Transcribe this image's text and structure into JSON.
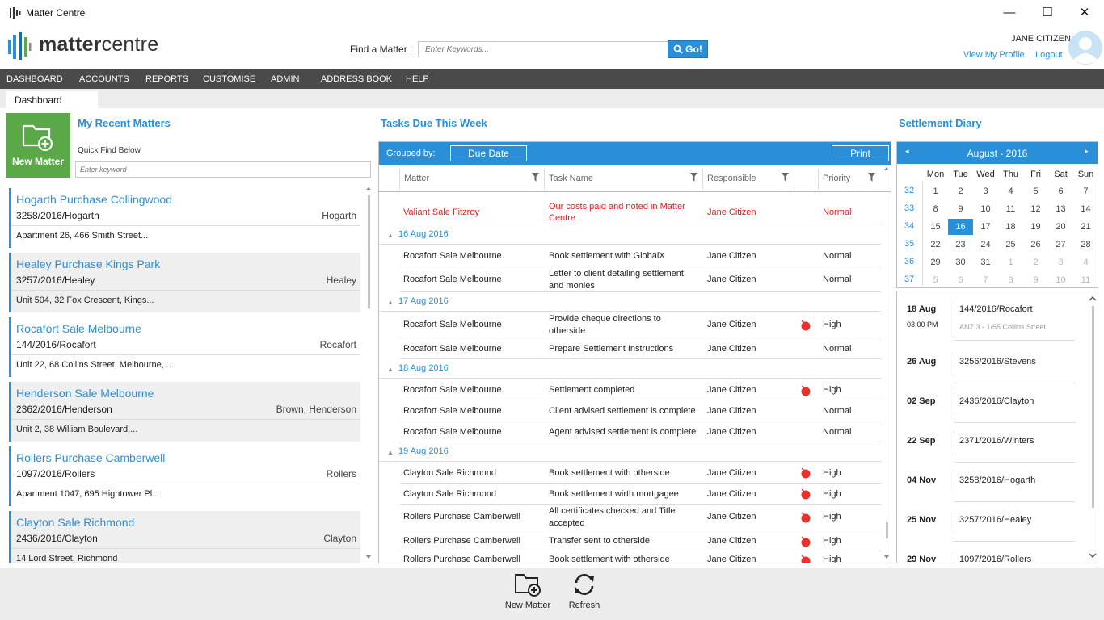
{
  "window": {
    "title": "Matter Centre",
    "minimize": "—",
    "maximize": "☐",
    "close": "✕"
  },
  "logo": {
    "text_bold": "matter",
    "text_light": "centre"
  },
  "header": {
    "find_label": "Find a Matter :",
    "find_placeholder": "Enter Keywords...",
    "go_label": "Go!",
    "user_name": "JANE CITIZEN",
    "view_profile": "View My Profile",
    "separator": "|",
    "logout": "Logout"
  },
  "menu": [
    "DASHBOARD",
    "ACCOUNTS",
    "REPORTS",
    "CUSTOMISE",
    "ADMIN",
    "ADDRESS BOOK",
    "HELP"
  ],
  "tab": {
    "label": "Dashboard"
  },
  "recent": {
    "new_matter_label": "New Matter",
    "title": "My Recent Matters",
    "quick_find_label": "Quick Find Below",
    "quick_find_placeholder": "Enter keyword",
    "matters": [
      {
        "title": "Hogarth Purchase Collingwood",
        "number": "3258/2016/Hogarth",
        "client": "Hogarth",
        "address": "Apartment 26, 466 Smith Street..."
      },
      {
        "title": "Healey Purchase Kings Park",
        "number": "3257/2016/Healey",
        "client": "Healey",
        "address": "Unit 504, 32 Fox Crescent, Kings..."
      },
      {
        "title": "Rocafort Sale Melbourne",
        "number": "144/2016/Rocafort",
        "client": "Rocafort",
        "address": "Unit 22, 68 Collins Street, Melbourne,..."
      },
      {
        "title": "Henderson Sale Melbourne",
        "number": "2362/2016/Henderson",
        "client": "Brown, Henderson",
        "address": "Unit 2, 38 William Boulevard,..."
      },
      {
        "title": "Rollers Purchase Camberwell",
        "number": "1097/2016/Rollers",
        "client": "Rollers",
        "address": "Apartment 1047, 695 Hightower Pl..."
      },
      {
        "title": "Clayton Sale Richmond",
        "number": "2436/2016/Clayton",
        "client": "Clayton",
        "address": "14 Lord Street, Richmond"
      }
    ]
  },
  "tasks": {
    "title": "Tasks Due This Week",
    "grouped_by_label": "Grouped by:",
    "group_button": "Due Date",
    "print_button": "Print",
    "columns": {
      "matter": "Matter",
      "task": "Task Name",
      "responsible": "Responsible",
      "priority": "Priority"
    },
    "partial_row": {
      "matter": "Valiant Sale Fitzroy",
      "task": "Our costs paid and noted in Matter Centre",
      "responsible": "Jane Citizen",
      "priority": "Normal"
    },
    "groups": [
      {
        "date": "16 Aug 2016",
        "rows": [
          {
            "matter": "Rocafort Sale Melbourne",
            "task": "Book settlement with GlobalX",
            "responsible": "Jane Citizen",
            "priority": "Normal",
            "flag": false
          },
          {
            "matter": "Rocafort Sale Melbourne",
            "task": "Letter to client detailing settlement and monies",
            "responsible": "Jane Citizen",
            "priority": "Normal",
            "flag": false
          }
        ]
      },
      {
        "date": "17 Aug 2016",
        "rows": [
          {
            "matter": "Rocafort Sale Melbourne",
            "task": "Provide cheque directions to otherside",
            "responsible": "Jane Citizen",
            "priority": "High",
            "flag": true
          },
          {
            "matter": "Rocafort Sale Melbourne",
            "task": "Prepare Settlement Instructions",
            "responsible": "Jane Citizen",
            "priority": "Normal",
            "flag": false
          }
        ]
      },
      {
        "date": "18 Aug 2016",
        "rows": [
          {
            "matter": "Rocafort Sale Melbourne",
            "task": "Settlement completed",
            "responsible": "Jane Citizen",
            "priority": "High",
            "flag": true
          },
          {
            "matter": "Rocafort Sale Melbourne",
            "task": "Client advised settlement is complete",
            "responsible": "Jane Citizen",
            "priority": "Normal",
            "flag": false
          },
          {
            "matter": "Rocafort Sale Melbourne",
            "task": "Agent advised settlement is complete",
            "responsible": "Jane Citizen",
            "priority": "Normal",
            "flag": false
          }
        ]
      },
      {
        "date": "19 Aug 2016",
        "rows": [
          {
            "matter": "Clayton Sale Richmond",
            "task": "Book settlement with otherside",
            "responsible": "Jane Citizen",
            "priority": "High",
            "flag": true
          },
          {
            "matter": "Clayton Sale Richmond",
            "task": "Book settlement wirth mortgagee",
            "responsible": "Jane Citizen",
            "priority": "High",
            "flag": true
          },
          {
            "matter": "Rollers Purchase Camberwell",
            "task": "All certificates checked and Title accepted",
            "responsible": "Jane Citizen",
            "priority": "High",
            "flag": true
          },
          {
            "matter": "Rollers Purchase Camberwell",
            "task": "Transfer sent to otherside",
            "responsible": "Jane Citizen",
            "priority": "High",
            "flag": true
          },
          {
            "matter": "Rollers Purchase Camberwell",
            "task": "Book settlement with otherside",
            "responsible": "Jane Citizen",
            "priority": "High",
            "flag": true
          }
        ]
      }
    ]
  },
  "diary": {
    "title": "Settlement Diary",
    "month": "August - 2016",
    "prev": "◂",
    "next": "▸",
    "dow": [
      "Mon",
      "Tue",
      "Wed",
      "Thu",
      "Fri",
      "Sat",
      "Sun"
    ],
    "weeks": [
      {
        "wk": "32",
        "days": [
          {
            "d": "1"
          },
          {
            "d": "2"
          },
          {
            "d": "3"
          },
          {
            "d": "4"
          },
          {
            "d": "5"
          },
          {
            "d": "6"
          },
          {
            "d": "7"
          }
        ]
      },
      {
        "wk": "33",
        "days": [
          {
            "d": "8"
          },
          {
            "d": "9"
          },
          {
            "d": "10"
          },
          {
            "d": "11"
          },
          {
            "d": "12"
          },
          {
            "d": "13"
          },
          {
            "d": "14"
          }
        ]
      },
      {
        "wk": "34",
        "days": [
          {
            "d": "15"
          },
          {
            "d": "16",
            "today": true
          },
          {
            "d": "17"
          },
          {
            "d": "18"
          },
          {
            "d": "19"
          },
          {
            "d": "20"
          },
          {
            "d": "21"
          }
        ]
      },
      {
        "wk": "35",
        "days": [
          {
            "d": "22"
          },
          {
            "d": "23"
          },
          {
            "d": "24"
          },
          {
            "d": "25"
          },
          {
            "d": "26"
          },
          {
            "d": "27"
          },
          {
            "d": "28"
          }
        ]
      },
      {
        "wk": "36",
        "days": [
          {
            "d": "29"
          },
          {
            "d": "30"
          },
          {
            "d": "31"
          },
          {
            "d": "1",
            "other": true
          },
          {
            "d": "2",
            "other": true
          },
          {
            "d": "3",
            "other": true
          },
          {
            "d": "4",
            "other": true
          }
        ]
      },
      {
        "wk": "37",
        "days": [
          {
            "d": "5",
            "other": true
          },
          {
            "d": "6",
            "other": true
          },
          {
            "d": "7",
            "other": true
          },
          {
            "d": "8",
            "other": true
          },
          {
            "d": "9",
            "other": true
          },
          {
            "d": "10",
            "other": true
          },
          {
            "d": "11",
            "other": true
          }
        ]
      }
    ],
    "entries": [
      {
        "date": "18 Aug",
        "matter": "144/2016/Rocafort",
        "time": "03:00 PM",
        "location": "ANZ 3 - 1/55 Collins Street"
      },
      {
        "date": "26 Aug",
        "matter": "3256/2016/Stevens"
      },
      {
        "date": "02 Sep",
        "matter": "2436/2016/Clayton"
      },
      {
        "date": "22 Sep",
        "matter": "2371/2016/Winters"
      },
      {
        "date": "04 Nov",
        "matter": "3258/2016/Hogarth"
      },
      {
        "date": "25 Nov",
        "matter": "3257/2016/Healey"
      },
      {
        "date": "29 Nov",
        "matter": "1097/2016/Rollers"
      }
    ]
  },
  "bottom": {
    "new_matter": "New Matter",
    "refresh": "Refresh"
  },
  "colors": {
    "accent": "#2a8fd6",
    "menu": "#4a4a4a",
    "new_matter": "#5aa848",
    "overdue": "#e01c24",
    "high_flag": "#e8302c"
  }
}
